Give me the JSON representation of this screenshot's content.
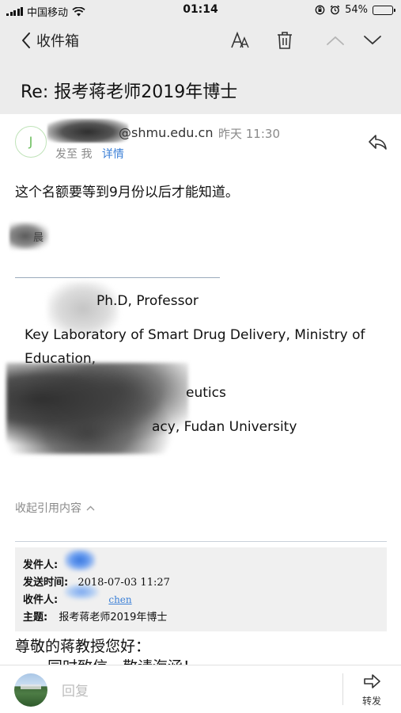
{
  "status_bar": {
    "carrier": "中国移动",
    "time": "01:14",
    "battery": "54%",
    "battery_level": 0.54
  },
  "nav": {
    "back_label": "收件箱"
  },
  "subject": "Re: 报考蒋老师2019年博士",
  "sender": {
    "avatar_letter": "J",
    "domain": "@shmu.edu.cn",
    "date": "昨天 11:30",
    "recipient_line": "发至 我",
    "detail_link": "详情"
  },
  "body": {
    "text": "这个名额要等到9月份以后才能知道。",
    "sig_char": "晨",
    "sig_title": "Ph.D, Professor",
    "sig_lab_1": "Key Laboratory of Smart Drug Delivery, Ministry of",
    "sig_lab_2": "Education,",
    "sig_dept": "eutics",
    "sig_univ": "acy, Fudan University"
  },
  "quote": {
    "collapse_label": "收起引用内容",
    "from_label": "发件人:",
    "sent_label": "发送时间:",
    "sent_value": "2018-07-03 11:27",
    "to_label": "收件人:",
    "to_tail": "chen",
    "subject_label": "主题:",
    "subject_value": "报考蒋老师2019年博士",
    "greeting": "尊敬的蒋教授您好：",
    "cut_line": "同时致信，敬请海涵！"
  },
  "bottom_bar": {
    "reply_placeholder": "回复",
    "forward_label": "转发"
  }
}
